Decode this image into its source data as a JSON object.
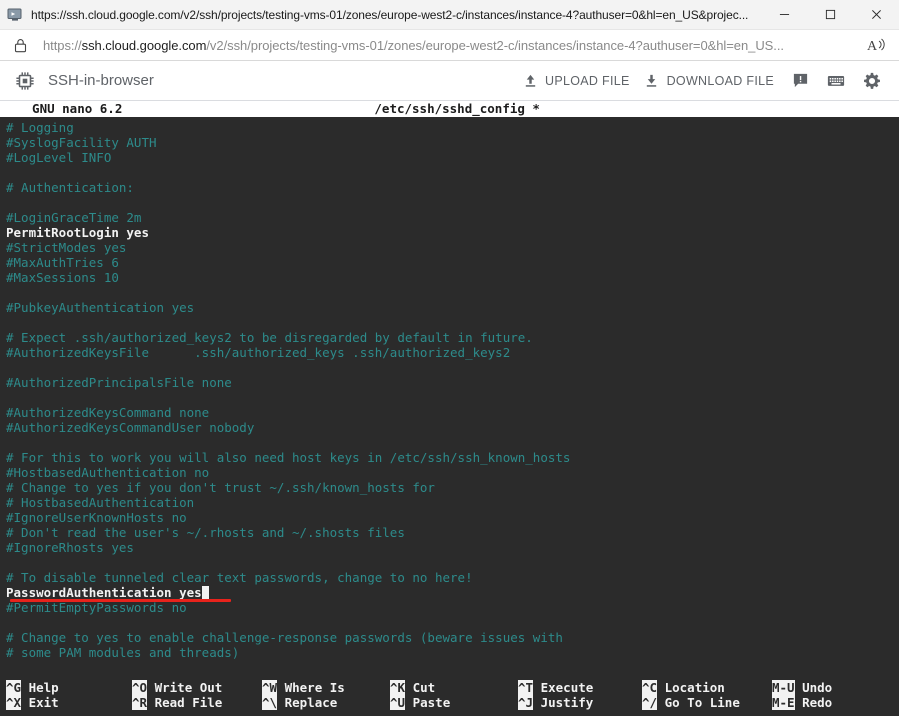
{
  "window": {
    "title": "https://ssh.cloud.google.com/v2/ssh/projects/testing-vms-01/zones/europe-west2-c/instances/instance-4?authuser=0&hl=en_US&projec...",
    "app_icon": "remote-desktop-icon",
    "minimize_label": "Minimize",
    "maximize_label": "Maximize",
    "close_label": "Close"
  },
  "address_bar": {
    "lock_icon": "lock-icon",
    "url_prefix": "https://",
    "url_domain": "ssh.cloud.google.com",
    "url_path": "/v2/ssh/projects/testing-vms-01/zones/europe-west2-c/instances/instance-4?authuser=0&hl=en_US...",
    "read_aloud_label": "Read aloud"
  },
  "app_toolbar": {
    "logo_icon": "chip-icon",
    "title": "SSH-in-browser",
    "upload_label": "UPLOAD FILE",
    "upload_icon": "upload-icon",
    "download_label": "DOWNLOAD FILE",
    "download_icon": "download-icon",
    "feedback_icon": "feedback-icon",
    "keyboard_icon": "keyboard-icon",
    "settings_icon": "gear-icon"
  },
  "terminal": {
    "background_color": "#2b2b2b",
    "comment_color": "#2d8b8b",
    "active_color": "#f2f2f2",
    "annotation_color": "#e8231c",
    "nano": {
      "version": "  GNU nano 6.2",
      "filename": "/etc/ssh/sshd_config *"
    },
    "lines": [
      {
        "text": "# Logging",
        "active": false
      },
      {
        "text": "#SyslogFacility AUTH",
        "active": false
      },
      {
        "text": "#LogLevel INFO",
        "active": false
      },
      {
        "text": "",
        "active": false
      },
      {
        "text": "# Authentication:",
        "active": false
      },
      {
        "text": "",
        "active": false
      },
      {
        "text": "#LoginGraceTime 2m",
        "active": false
      },
      {
        "text": "PermitRootLogin yes",
        "active": true
      },
      {
        "text": "#StrictModes yes",
        "active": false
      },
      {
        "text": "#MaxAuthTries 6",
        "active": false
      },
      {
        "text": "#MaxSessions 10",
        "active": false
      },
      {
        "text": "",
        "active": false
      },
      {
        "text": "#PubkeyAuthentication yes",
        "active": false
      },
      {
        "text": "",
        "active": false
      },
      {
        "text": "# Expect .ssh/authorized_keys2 to be disregarded by default in future.",
        "active": false
      },
      {
        "text": "#AuthorizedKeysFile\t.ssh/authorized_keys .ssh/authorized_keys2",
        "active": false
      },
      {
        "text": "",
        "active": false
      },
      {
        "text": "#AuthorizedPrincipalsFile none",
        "active": false
      },
      {
        "text": "",
        "active": false
      },
      {
        "text": "#AuthorizedKeysCommand none",
        "active": false
      },
      {
        "text": "#AuthorizedKeysCommandUser nobody",
        "active": false
      },
      {
        "text": "",
        "active": false
      },
      {
        "text": "# For this to work you will also need host keys in /etc/ssh/ssh_known_hosts",
        "active": false
      },
      {
        "text": "#HostbasedAuthentication no",
        "active": false
      },
      {
        "text": "# Change to yes if you don't trust ~/.ssh/known_hosts for",
        "active": false
      },
      {
        "text": "# HostbasedAuthentication",
        "active": false
      },
      {
        "text": "#IgnoreUserKnownHosts no",
        "active": false
      },
      {
        "text": "# Don't read the user's ~/.rhosts and ~/.shosts files",
        "active": false
      },
      {
        "text": "#IgnoreRhosts yes",
        "active": false
      },
      {
        "text": "",
        "active": false
      },
      {
        "text": "# To disable tunneled clear text passwords, change to no here!",
        "active": false
      },
      {
        "text": "PasswordAuthentication yes",
        "active": true,
        "cursor": true,
        "underline": true
      },
      {
        "text": "#PermitEmptyPasswords no",
        "active": false
      },
      {
        "text": "",
        "active": false
      },
      {
        "text": "# Change to yes to enable challenge-response passwords (beware issues with",
        "active": false
      },
      {
        "text": "# some PAM modules and threads)",
        "active": false
      }
    ],
    "help_columns": [
      {
        "top": {
          "key": "^G",
          "label": "Help"
        },
        "bottom": {
          "key": "^X",
          "label": "Exit"
        }
      },
      {
        "top": {
          "key": "^O",
          "label": "Write Out"
        },
        "bottom": {
          "key": "^R",
          "label": "Read File"
        }
      },
      {
        "top": {
          "key": "^W",
          "label": "Where Is"
        },
        "bottom": {
          "key": "^\\",
          "label": "Replace"
        }
      },
      {
        "top": {
          "key": "^K",
          "label": "Cut"
        },
        "bottom": {
          "key": "^U",
          "label": "Paste"
        }
      },
      {
        "top": {
          "key": "^T",
          "label": "Execute"
        },
        "bottom": {
          "key": "^J",
          "label": "Justify"
        }
      },
      {
        "top": {
          "key": "^C",
          "label": "Location"
        },
        "bottom": {
          "key": "^/",
          "label": "Go To Line"
        }
      },
      {
        "top": {
          "key": "M-U",
          "label": "Undo"
        },
        "bottom": {
          "key": "M-E",
          "label": "Redo"
        }
      }
    ]
  }
}
